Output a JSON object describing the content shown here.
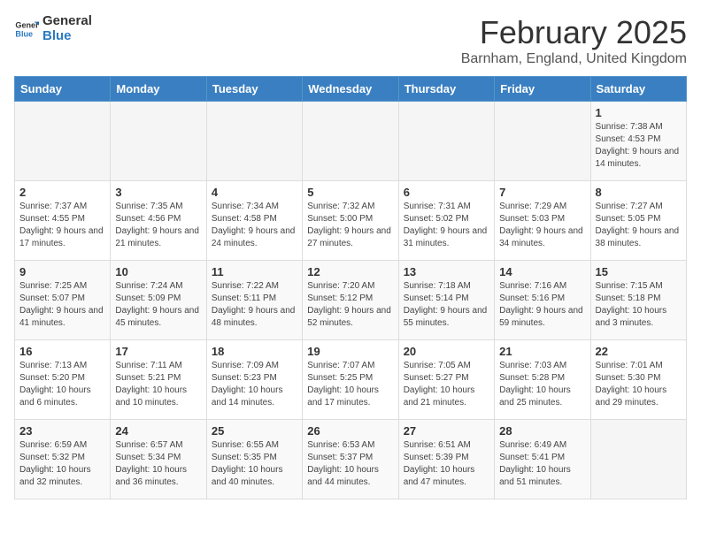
{
  "logo": {
    "general": "General",
    "blue": "Blue"
  },
  "title": "February 2025",
  "subtitle": "Barnham, England, United Kingdom",
  "weekdays": [
    "Sunday",
    "Monday",
    "Tuesday",
    "Wednesday",
    "Thursday",
    "Friday",
    "Saturday"
  ],
  "weeks": [
    [
      {
        "day": "",
        "info": ""
      },
      {
        "day": "",
        "info": ""
      },
      {
        "day": "",
        "info": ""
      },
      {
        "day": "",
        "info": ""
      },
      {
        "day": "",
        "info": ""
      },
      {
        "day": "",
        "info": ""
      },
      {
        "day": "1",
        "info": "Sunrise: 7:38 AM\nSunset: 4:53 PM\nDaylight: 9 hours and 14 minutes."
      }
    ],
    [
      {
        "day": "2",
        "info": "Sunrise: 7:37 AM\nSunset: 4:55 PM\nDaylight: 9 hours and 17 minutes."
      },
      {
        "day": "3",
        "info": "Sunrise: 7:35 AM\nSunset: 4:56 PM\nDaylight: 9 hours and 21 minutes."
      },
      {
        "day": "4",
        "info": "Sunrise: 7:34 AM\nSunset: 4:58 PM\nDaylight: 9 hours and 24 minutes."
      },
      {
        "day": "5",
        "info": "Sunrise: 7:32 AM\nSunset: 5:00 PM\nDaylight: 9 hours and 27 minutes."
      },
      {
        "day": "6",
        "info": "Sunrise: 7:31 AM\nSunset: 5:02 PM\nDaylight: 9 hours and 31 minutes."
      },
      {
        "day": "7",
        "info": "Sunrise: 7:29 AM\nSunset: 5:03 PM\nDaylight: 9 hours and 34 minutes."
      },
      {
        "day": "8",
        "info": "Sunrise: 7:27 AM\nSunset: 5:05 PM\nDaylight: 9 hours and 38 minutes."
      }
    ],
    [
      {
        "day": "9",
        "info": "Sunrise: 7:25 AM\nSunset: 5:07 PM\nDaylight: 9 hours and 41 minutes."
      },
      {
        "day": "10",
        "info": "Sunrise: 7:24 AM\nSunset: 5:09 PM\nDaylight: 9 hours and 45 minutes."
      },
      {
        "day": "11",
        "info": "Sunrise: 7:22 AM\nSunset: 5:11 PM\nDaylight: 9 hours and 48 minutes."
      },
      {
        "day": "12",
        "info": "Sunrise: 7:20 AM\nSunset: 5:12 PM\nDaylight: 9 hours and 52 minutes."
      },
      {
        "day": "13",
        "info": "Sunrise: 7:18 AM\nSunset: 5:14 PM\nDaylight: 9 hours and 55 minutes."
      },
      {
        "day": "14",
        "info": "Sunrise: 7:16 AM\nSunset: 5:16 PM\nDaylight: 9 hours and 59 minutes."
      },
      {
        "day": "15",
        "info": "Sunrise: 7:15 AM\nSunset: 5:18 PM\nDaylight: 10 hours and 3 minutes."
      }
    ],
    [
      {
        "day": "16",
        "info": "Sunrise: 7:13 AM\nSunset: 5:20 PM\nDaylight: 10 hours and 6 minutes."
      },
      {
        "day": "17",
        "info": "Sunrise: 7:11 AM\nSunset: 5:21 PM\nDaylight: 10 hours and 10 minutes."
      },
      {
        "day": "18",
        "info": "Sunrise: 7:09 AM\nSunset: 5:23 PM\nDaylight: 10 hours and 14 minutes."
      },
      {
        "day": "19",
        "info": "Sunrise: 7:07 AM\nSunset: 5:25 PM\nDaylight: 10 hours and 17 minutes."
      },
      {
        "day": "20",
        "info": "Sunrise: 7:05 AM\nSunset: 5:27 PM\nDaylight: 10 hours and 21 minutes."
      },
      {
        "day": "21",
        "info": "Sunrise: 7:03 AM\nSunset: 5:28 PM\nDaylight: 10 hours and 25 minutes."
      },
      {
        "day": "22",
        "info": "Sunrise: 7:01 AM\nSunset: 5:30 PM\nDaylight: 10 hours and 29 minutes."
      }
    ],
    [
      {
        "day": "23",
        "info": "Sunrise: 6:59 AM\nSunset: 5:32 PM\nDaylight: 10 hours and 32 minutes."
      },
      {
        "day": "24",
        "info": "Sunrise: 6:57 AM\nSunset: 5:34 PM\nDaylight: 10 hours and 36 minutes."
      },
      {
        "day": "25",
        "info": "Sunrise: 6:55 AM\nSunset: 5:35 PM\nDaylight: 10 hours and 40 minutes."
      },
      {
        "day": "26",
        "info": "Sunrise: 6:53 AM\nSunset: 5:37 PM\nDaylight: 10 hours and 44 minutes."
      },
      {
        "day": "27",
        "info": "Sunrise: 6:51 AM\nSunset: 5:39 PM\nDaylight: 10 hours and 47 minutes."
      },
      {
        "day": "28",
        "info": "Sunrise: 6:49 AM\nSunset: 5:41 PM\nDaylight: 10 hours and 51 minutes."
      },
      {
        "day": "",
        "info": ""
      }
    ]
  ]
}
